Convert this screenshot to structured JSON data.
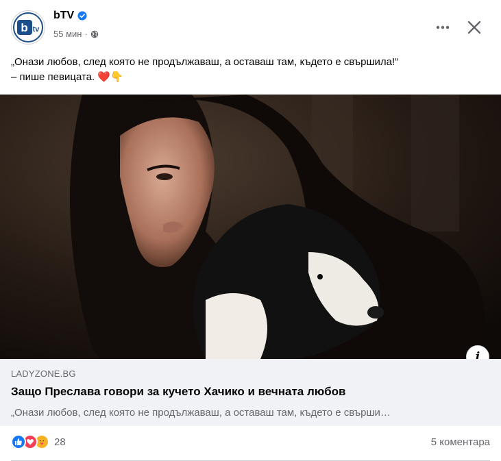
{
  "post": {
    "page_name": "bTV",
    "verified_icon": "verified-badge-icon",
    "time": "55 мин",
    "separator": "·",
    "audience_icon": "globe-icon",
    "logo": {
      "main": "b",
      "small": "tv",
      "brand_color": "#1c4e8a"
    },
    "text_line1": "„Онази любов, след която не продължаваш, а оставаш там, където е свършила!“",
    "text_line2": "– пише певицата.",
    "text_emojis": "❤️👇"
  },
  "toolbar": {
    "more_icon": "more-horizontal-icon",
    "close_icon": "close-icon"
  },
  "link_preview": {
    "domain": "LADYZONE.BG",
    "title": "Защо Преслава говори за кучето Хачико и вечната любов",
    "description": "„Онази любов, след която не продължаваш, а оставаш там, където е свърши…",
    "info_label": "i"
  },
  "engagement": {
    "reaction_icons": [
      "like-reaction-icon",
      "love-reaction-icon",
      "care-reaction-icon"
    ],
    "reaction_count": "28",
    "comments": "5 коментара"
  },
  "colors": {
    "accent": "#1877f2",
    "love": "#f33e58",
    "care": "#f7b125",
    "secondary_text": "#65676b",
    "link_box_bg": "#f0f2f5"
  }
}
